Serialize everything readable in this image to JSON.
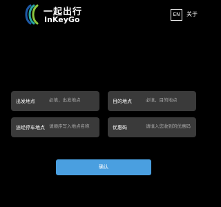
{
  "header": {
    "logo_cn": "一起出行",
    "logo_en": "InKeyGo",
    "lang_label": "EN",
    "about_label": "关于"
  },
  "form": {
    "origin": {
      "label": "出发地点",
      "placeholder": "必填，出发地点"
    },
    "destination": {
      "label": "目的地点",
      "placeholder": "必填，目的地点"
    },
    "via": {
      "label": "途经停车地点",
      "placeholder": "请顺序写入地点名称"
    },
    "promo": {
      "label": "优惠码",
      "placeholder": "请填入您收到的优惠码"
    },
    "confirm_label": "确认"
  },
  "colors": {
    "background": "#000000",
    "field_bg": "#3a3a3a",
    "accent": "#4a9fe0",
    "logo_blue": "#1e5aa8",
    "logo_green": "#8cc63f",
    "logo_teal": "#2aa8a0"
  },
  "icons": {
    "logo": "inkeygo-logo-icon"
  }
}
